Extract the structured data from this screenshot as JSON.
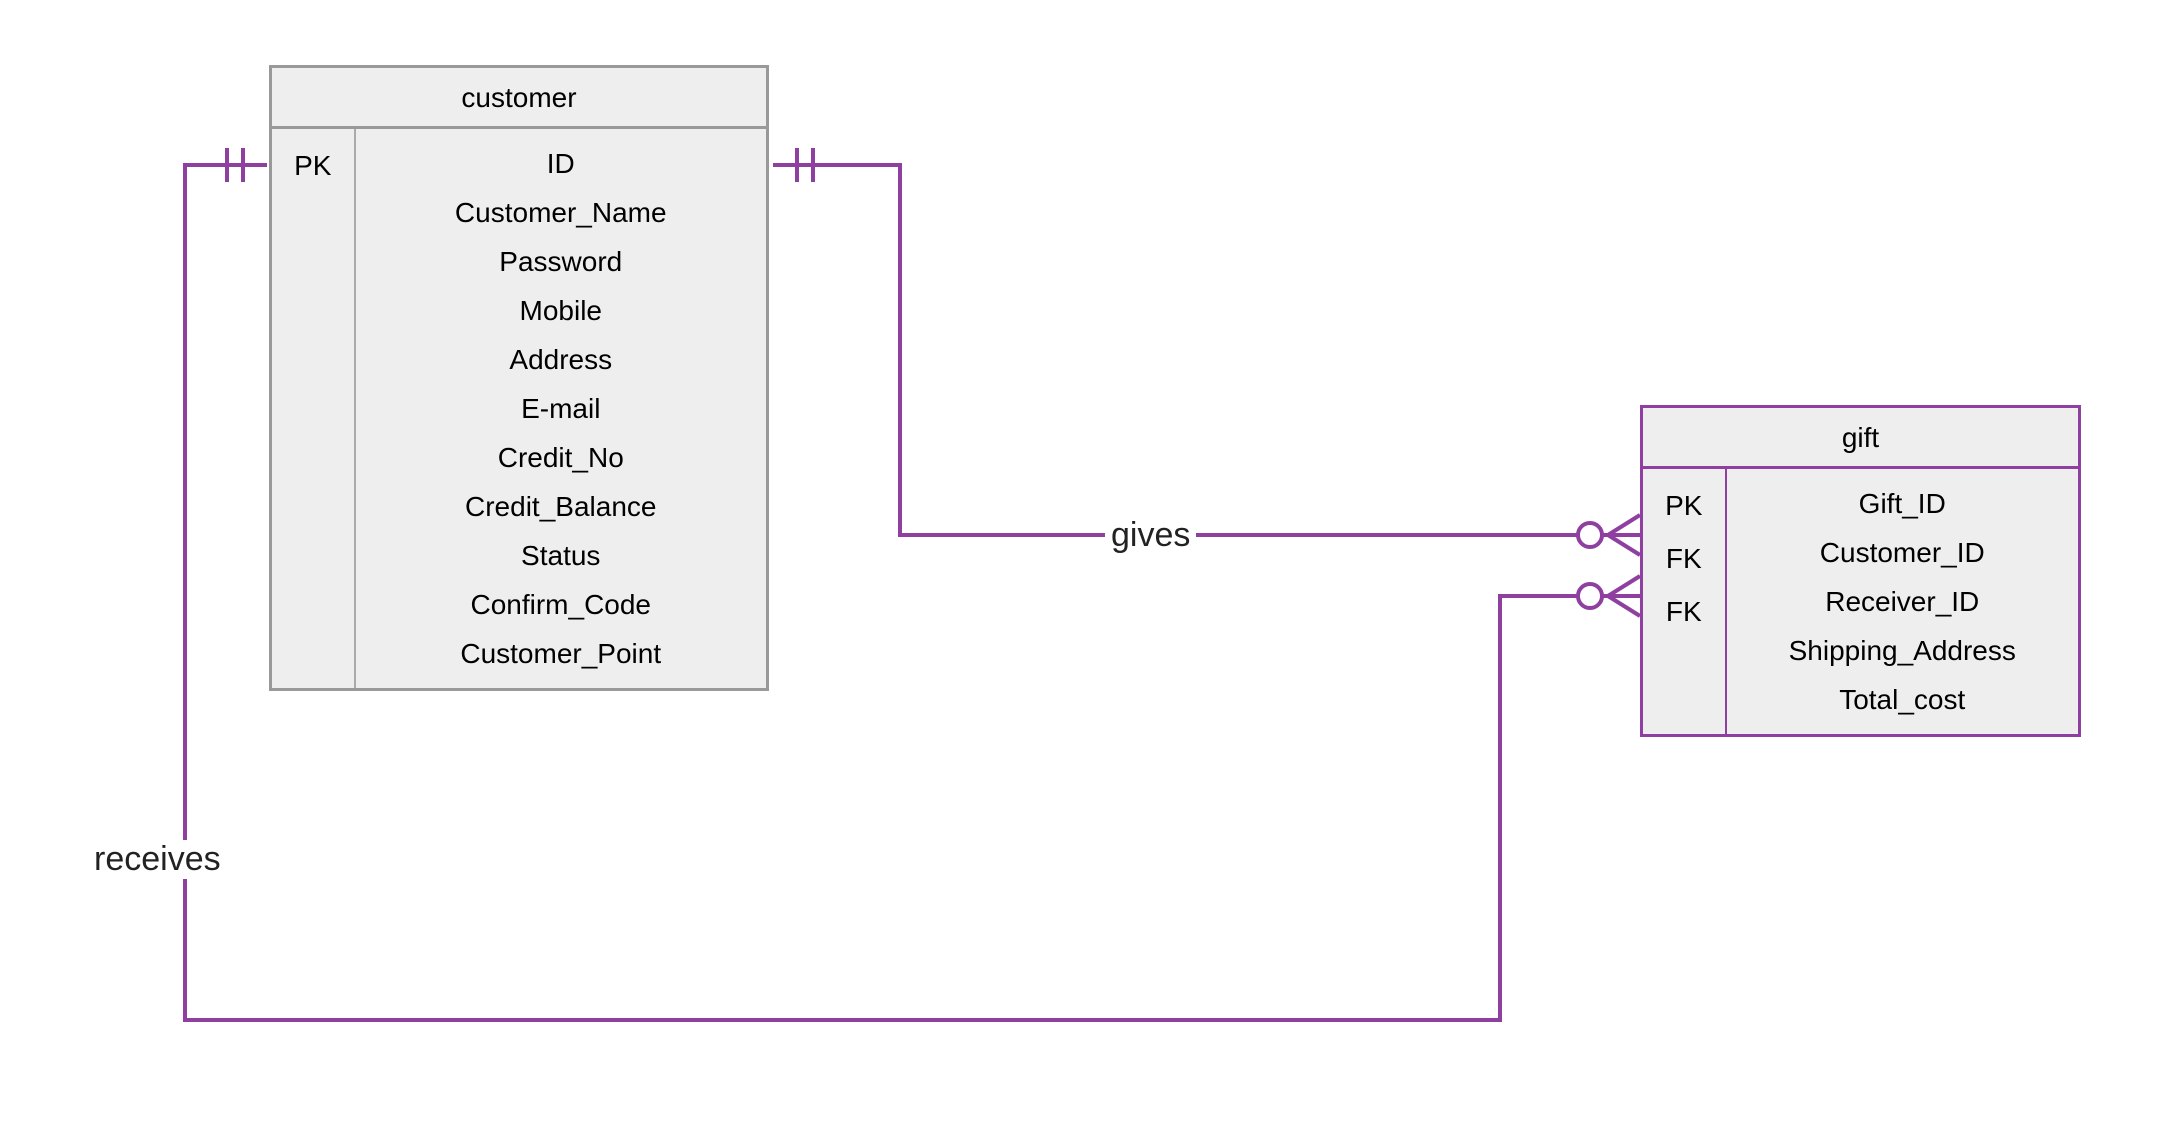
{
  "diagram_type": "entity-relationship",
  "entities": {
    "customer": {
      "title": "customer",
      "border_color": "#999",
      "keys": [
        "PK",
        "",
        "",
        "",
        "",
        "",
        "",
        "",
        "",
        "",
        ""
      ],
      "attributes": [
        "ID",
        "Customer_Name",
        "Password",
        "Mobile",
        "Address",
        "E-mail",
        "Credit_No",
        "Credit_Balance",
        "Status",
        "Confirm_Code",
        "Customer_Point"
      ]
    },
    "gift": {
      "title": "gift",
      "border_color": "#8e3fa0",
      "keys": [
        "PK",
        "FK",
        "FK",
        "",
        ""
      ],
      "attributes": [
        "Gift_ID",
        "Customer_ID",
        "Receiver_ID",
        "Shipping_Address",
        "Total_cost"
      ]
    }
  },
  "relationships": [
    {
      "from_entity": "customer",
      "from_attr": "ID",
      "to_entity": "gift",
      "to_attr": "Customer_ID",
      "label": "gives",
      "from_cardinality": "one-and-only-one",
      "to_cardinality": "zero-or-many"
    },
    {
      "from_entity": "customer",
      "from_attr": "ID",
      "to_entity": "gift",
      "to_attr": "Receiver_ID",
      "label": "receives",
      "from_cardinality": "one-and-only-one",
      "to_cardinality": "zero-or-many"
    }
  ],
  "labels": {
    "gives": "gives",
    "receives": "receives"
  },
  "colors": {
    "connector": "#8e3fa0",
    "entity_gray": "#999",
    "entity_purple": "#8e3fa0",
    "bg": "#eee"
  }
}
